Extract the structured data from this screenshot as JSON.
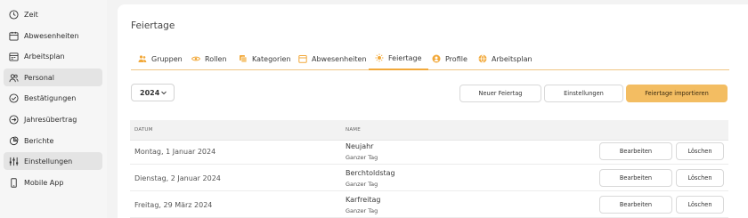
{
  "sidebar": {
    "items": [
      {
        "label": "Zeit",
        "icon": "clock-icon"
      },
      {
        "label": "Abwesenheiten",
        "icon": "calendar-icon"
      },
      {
        "label": "Arbeitsplan",
        "icon": "schedule-icon"
      },
      {
        "label": "Personal",
        "icon": "people-icon",
        "active": true
      },
      {
        "label": "Bestätigungen",
        "icon": "check-circle-icon"
      },
      {
        "label": "Jahresübertrag",
        "icon": "arrow-circle-icon"
      },
      {
        "label": "Berichte",
        "icon": "pie-chart-icon"
      },
      {
        "label": "Einstellungen",
        "icon": "sliders-icon",
        "active": true
      },
      {
        "label": "Mobile App",
        "icon": "phone-icon"
      }
    ]
  },
  "page": {
    "title": "Feiertage"
  },
  "tabs": [
    {
      "label": "Gruppen",
      "icon": "group-icon"
    },
    {
      "label": "Rollen",
      "icon": "eye-icon"
    },
    {
      "label": "Kategorien",
      "icon": "copy-icon"
    },
    {
      "label": "Abwesenheiten",
      "icon": "calendar-icon"
    },
    {
      "label": "Feiertage",
      "icon": "sun-icon",
      "active": true
    },
    {
      "label": "Profile",
      "icon": "profile-icon"
    },
    {
      "label": "Arbeitsplan",
      "icon": "globe-icon"
    }
  ],
  "toolbar": {
    "year": "2024",
    "new_holiday": "Neuer Feiertag",
    "settings": "Einstellungen",
    "import": "Feiertage importieren"
  },
  "table": {
    "columns": {
      "date": "DATUM",
      "name": "NAME"
    },
    "rows": [
      {
        "date": "Montag, 1 Januar 2024",
        "name": "Neujahr",
        "duration": "Ganzer Tag"
      },
      {
        "date": "Dienstag, 2 Januar 2024",
        "name": "Berchtoldstag",
        "duration": "Ganzer Tag"
      },
      {
        "date": "Freitag, 29 März 2024",
        "name": "Karfreitag",
        "duration": "Ganzer Tag"
      }
    ],
    "edit_label": "Bearbeiten",
    "delete_label": "Löschen"
  },
  "colors": {
    "accent": "#f2a93b",
    "primary_button": "#f3bd62",
    "active_nav": "#e4e4e4"
  }
}
